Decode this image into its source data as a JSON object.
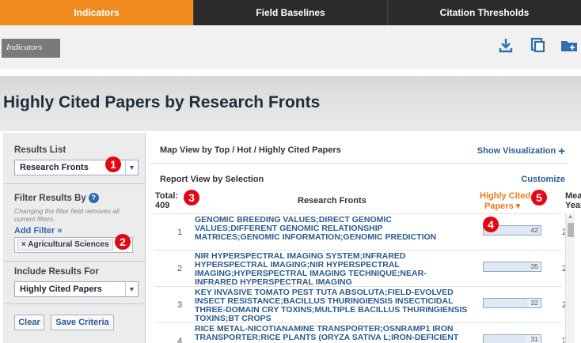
{
  "tabs": [
    {
      "label": "Indicators"
    },
    {
      "label": "Field Baselines"
    },
    {
      "label": "Citation Thresholds"
    }
  ],
  "breadcrumb": "Indicators",
  "toolbar_icons": [
    "download-icon",
    "print-icon",
    "folder-add-icon"
  ],
  "page_title": "Highly Cited Papers by Research Fronts",
  "sidebar": {
    "results_list_label": "Results List",
    "results_list_value": "Research Fronts",
    "filter_label": "Filter Results By",
    "filter_note": "Changing the filter field removes all current filters.",
    "add_filter": "Add Filter »",
    "filter_chip": "× Agricultural Sciences",
    "include_label": "Include Results For",
    "include_value": "Highly Cited Papers",
    "clear": "Clear",
    "save": "Save Criteria"
  },
  "main": {
    "map_view_label": "Map View by Top / Hot / Highly Cited Papers",
    "show_visualization": "Show Visualization",
    "show_visualization_plus": "+",
    "report_view_label": "Report View by Selection",
    "customize": "Customize",
    "total_label": "Total:",
    "total_value": "409",
    "col_research_fronts": "Research Fronts",
    "col_hcp_line1": "Highly Cited",
    "col_hcp_line2": "Papers ▾",
    "col_mean_line1": "Mea",
    "col_mean_line2": "Year"
  },
  "rows": [
    {
      "num": "1",
      "fronts": "GENOMIC BREEDING VALUES;DIRECT GENOMIC VALUES;DIFFERENT GENOMIC RELATIONSHIP MATRICES;GENOMIC INFORMATION;GENOMIC PREDICTION",
      "hcp": "42",
      "hcp_value": 42,
      "year": "2"
    },
    {
      "num": "2",
      "fronts": "NIR HYPERSPECTRAL IMAGING SYSTEM;INFRARED HYPERSPECTRAL IMAGING;NIR HYPERSPECTRAL IMAGING;HYPERSPECTRAL IMAGING TECHNIQUE;NEAR-INFRARED HYPERSPECTRAL IMAGING",
      "hcp": "35",
      "hcp_value": 35,
      "year": "2"
    },
    {
      "num": "3",
      "fronts": "KEY INVASIVE TOMATO PEST TUTA ABSOLUTA;FIELD-EVOLVED INSECT RESISTANCE;BACILLUS THURINGIENSIS INSECTICIDAL THREE-DOMAIN CRY TOXINS;MULTIPLE BACILLUS THURINGIENSIS TOXINS;BT CROPS",
      "hcp": "32",
      "hcp_value": 32,
      "year": "2"
    },
    {
      "num": "4",
      "fronts": "RICE METAL-NICOTIANAMINE TRANSPORTER;OSNRAMP1 IRON TRANSPORTER;RICE PLANTS (ORYZA SATIVA L;IRON-DEFICIENT RICE ROOTS;IRON UPTAKE",
      "hcp": "31",
      "hcp_value": 31,
      "year": "2"
    }
  ],
  "callouts": [
    "1",
    "2",
    "3",
    "4",
    "5"
  ],
  "colors": {
    "accent": "#f28b1e",
    "tab_dark": "#2b2b2b",
    "link": "#2a5b8f",
    "callout": "#e30613"
  }
}
